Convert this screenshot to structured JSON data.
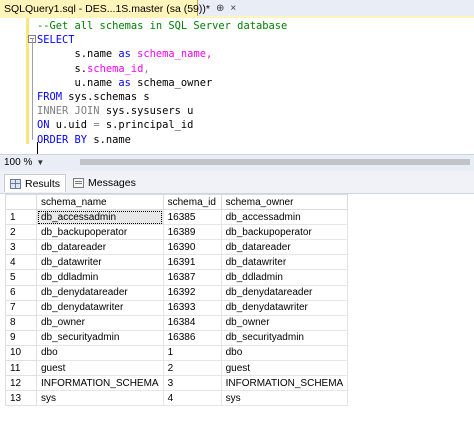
{
  "tab": {
    "title": "SQLQuery1.sql - DES...1S.master (sa (59))*",
    "pin": "⊕",
    "close": "×"
  },
  "editor": {
    "comment": "--Get all schemas in SQL Server database",
    "line_select": "SELECT",
    "line2_col": "s.name",
    "line2_as": "as",
    "line2_alias": "schema_name,",
    "line3_col": "s.",
    "line3_col2": "schema_id",
    "line3_comma": ",",
    "line4_col": "u.name",
    "line4_as": "as",
    "line4_alias": "schema_owner",
    "from_kw": "FROM",
    "from_obj": "sys.schemas s",
    "join_kw": "INNER JOIN",
    "join_obj": "sys.sysusers u",
    "on_kw": "ON",
    "on_expr_a": "u.uid",
    "on_eq": "=",
    "on_expr_b": "s.principal_id",
    "order_kw": "ORDER BY",
    "order_col": "s.name"
  },
  "zoom": {
    "value": "100 %"
  },
  "results_tabs": {
    "results": "Results",
    "messages": "Messages"
  },
  "grid": {
    "columns": [
      "schema_name",
      "schema_id",
      "schema_owner"
    ],
    "rows": [
      [
        "1",
        "db_accessadmin",
        "16385",
        "db_accessadmin"
      ],
      [
        "2",
        "db_backupoperator",
        "16389",
        "db_backupoperator"
      ],
      [
        "3",
        "db_datareader",
        "16390",
        "db_datareader"
      ],
      [
        "4",
        "db_datawriter",
        "16391",
        "db_datawriter"
      ],
      [
        "5",
        "db_ddladmin",
        "16387",
        "db_ddladmin"
      ],
      [
        "6",
        "db_denydatareader",
        "16392",
        "db_denydatareader"
      ],
      [
        "7",
        "db_denydatawriter",
        "16393",
        "db_denydatawriter"
      ],
      [
        "8",
        "db_owner",
        "16384",
        "db_owner"
      ],
      [
        "9",
        "db_securityadmin",
        "16386",
        "db_securityadmin"
      ],
      [
        "10",
        "dbo",
        "1",
        "dbo"
      ],
      [
        "11",
        "guest",
        "2",
        "guest"
      ],
      [
        "12",
        "INFORMATION_SCHEMA",
        "3",
        "INFORMATION_SCHEMA"
      ],
      [
        "13",
        "sys",
        "4",
        "sys"
      ]
    ]
  }
}
